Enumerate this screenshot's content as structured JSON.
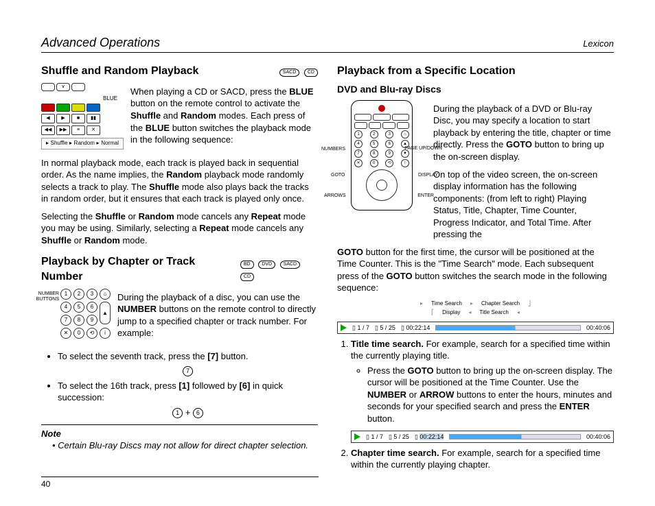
{
  "hdr": {
    "title": "Advanced Operations",
    "brand": "Lexicon"
  },
  "s1": {
    "h": "Shuffle and Random Playback",
    "badges": [
      "SACD",
      "CD"
    ],
    "blue": "BLUE",
    "seq": [
      "Shuffle",
      "Random",
      "Normal"
    ],
    "p1a": "When playing a CD or SACD, press the ",
    "p1b": " button on the remote control to activate the ",
    "p1c": " and ",
    "p1d": " modes. Each press of the ",
    "p1e": " button switches the playback mode in the following sequence:",
    "b_blue": "BLUE",
    "b_sh": "Shuffle",
    "b_rn": "Random",
    "p2a": "In normal playback mode, each track is played back in sequential order. As the name implies, the ",
    "p2b": " playback mode randomly selects a track to play. The ",
    "p2c": " mode also plays back the tracks in random order, but it ensures that each track is played only once.",
    "p3a": "Selecting the ",
    "p3b": " or ",
    "p3c": " mode cancels any ",
    "p3d": " mode you may be using. Similarly, selecting a ",
    "p3e": " mode cancels any ",
    "p3f": " or ",
    "p3g": " mode.",
    "b_rp": "Repeat"
  },
  "s2": {
    "h": "Playback by Chapter or Track Number",
    "badges": [
      "BD",
      "DVD",
      "SACD",
      "CD"
    ],
    "numlbl": "NUMBER BUTTONS",
    "p1a": "During the playback of a disc, you can use the ",
    "p1b": " buttons on the remote control to directly jump to a specified chapter or track number. For example:",
    "b_num": "NUMBER",
    "li1a": "To select the seventh track, press the ",
    "li1b": " button.",
    "b7": "[7]",
    "li2a": "To select the 16th track, press ",
    "li2b": " followed by ",
    "li2c": " in quick succession:",
    "b1": "[1]",
    "b6": "[6]",
    "noteH": "Note",
    "noteB": "Certain Blu-ray Discs may not allow for direct chapter selection.",
    "c1": "1",
    "c6": "6",
    "c7": "7",
    "plus": "+"
  },
  "s3": {
    "h": "Playback from a Specific Location",
    "sub": "DVD and Blu-ray Discs",
    "lbls": {
      "num": "NUMBERS",
      "goto": "GOTO",
      "arr": "ARROWS",
      "page": "PAGE UP/DOWN",
      "disp": "DISPLAY",
      "ent": "ENTER"
    },
    "p1a": "During the playback of a DVD or Blu-ray Disc, you may specify a location to start playback by entering the title, chapter or time directly. Press the ",
    "p1b": " button to bring up the on-screen display.",
    "b_goto": "GOTO",
    "p2a": "On top of the video screen, the on-screen display information has the following components: (from left to right) Playing Status, Title, Chapter, Time Counter, Progress Indicator, and Total Time. After pressing the ",
    "p2b": " button for the first time, the cursor will be positioned at the Time Counter. This is the \"Time Search\" mode. Each subsequent press of the ",
    "p2c": " button switches the search mode in the following sequence:",
    "seq": [
      "Time Search",
      "Chapter Search",
      "Display",
      "Title Search"
    ],
    "bar": {
      "t": "1 / 7",
      "c": "5 / 25",
      "tc": "00:22:14",
      "tot": "00:40:06"
    },
    "li1a": "Title time search.",
    "li1b": " For example, search for a specified time within the currently playing title.",
    "sub1a": "Press the ",
    "sub1b": " button to bring up the on-screen display. The cursor will be positioned at the Time Counter. Use the ",
    "sub1c": " or ",
    "sub1d": " buttons to enter the hours, minutes and seconds for your specified search and press the ",
    "sub1e": " button.",
    "b_num": "NUMBER",
    "b_arr": "ARROW",
    "b_ent": "ENTER",
    "li2a": "Chapter time search.",
    "li2b": " For example, search for a specified time within the currently playing chapter."
  },
  "page": "40"
}
